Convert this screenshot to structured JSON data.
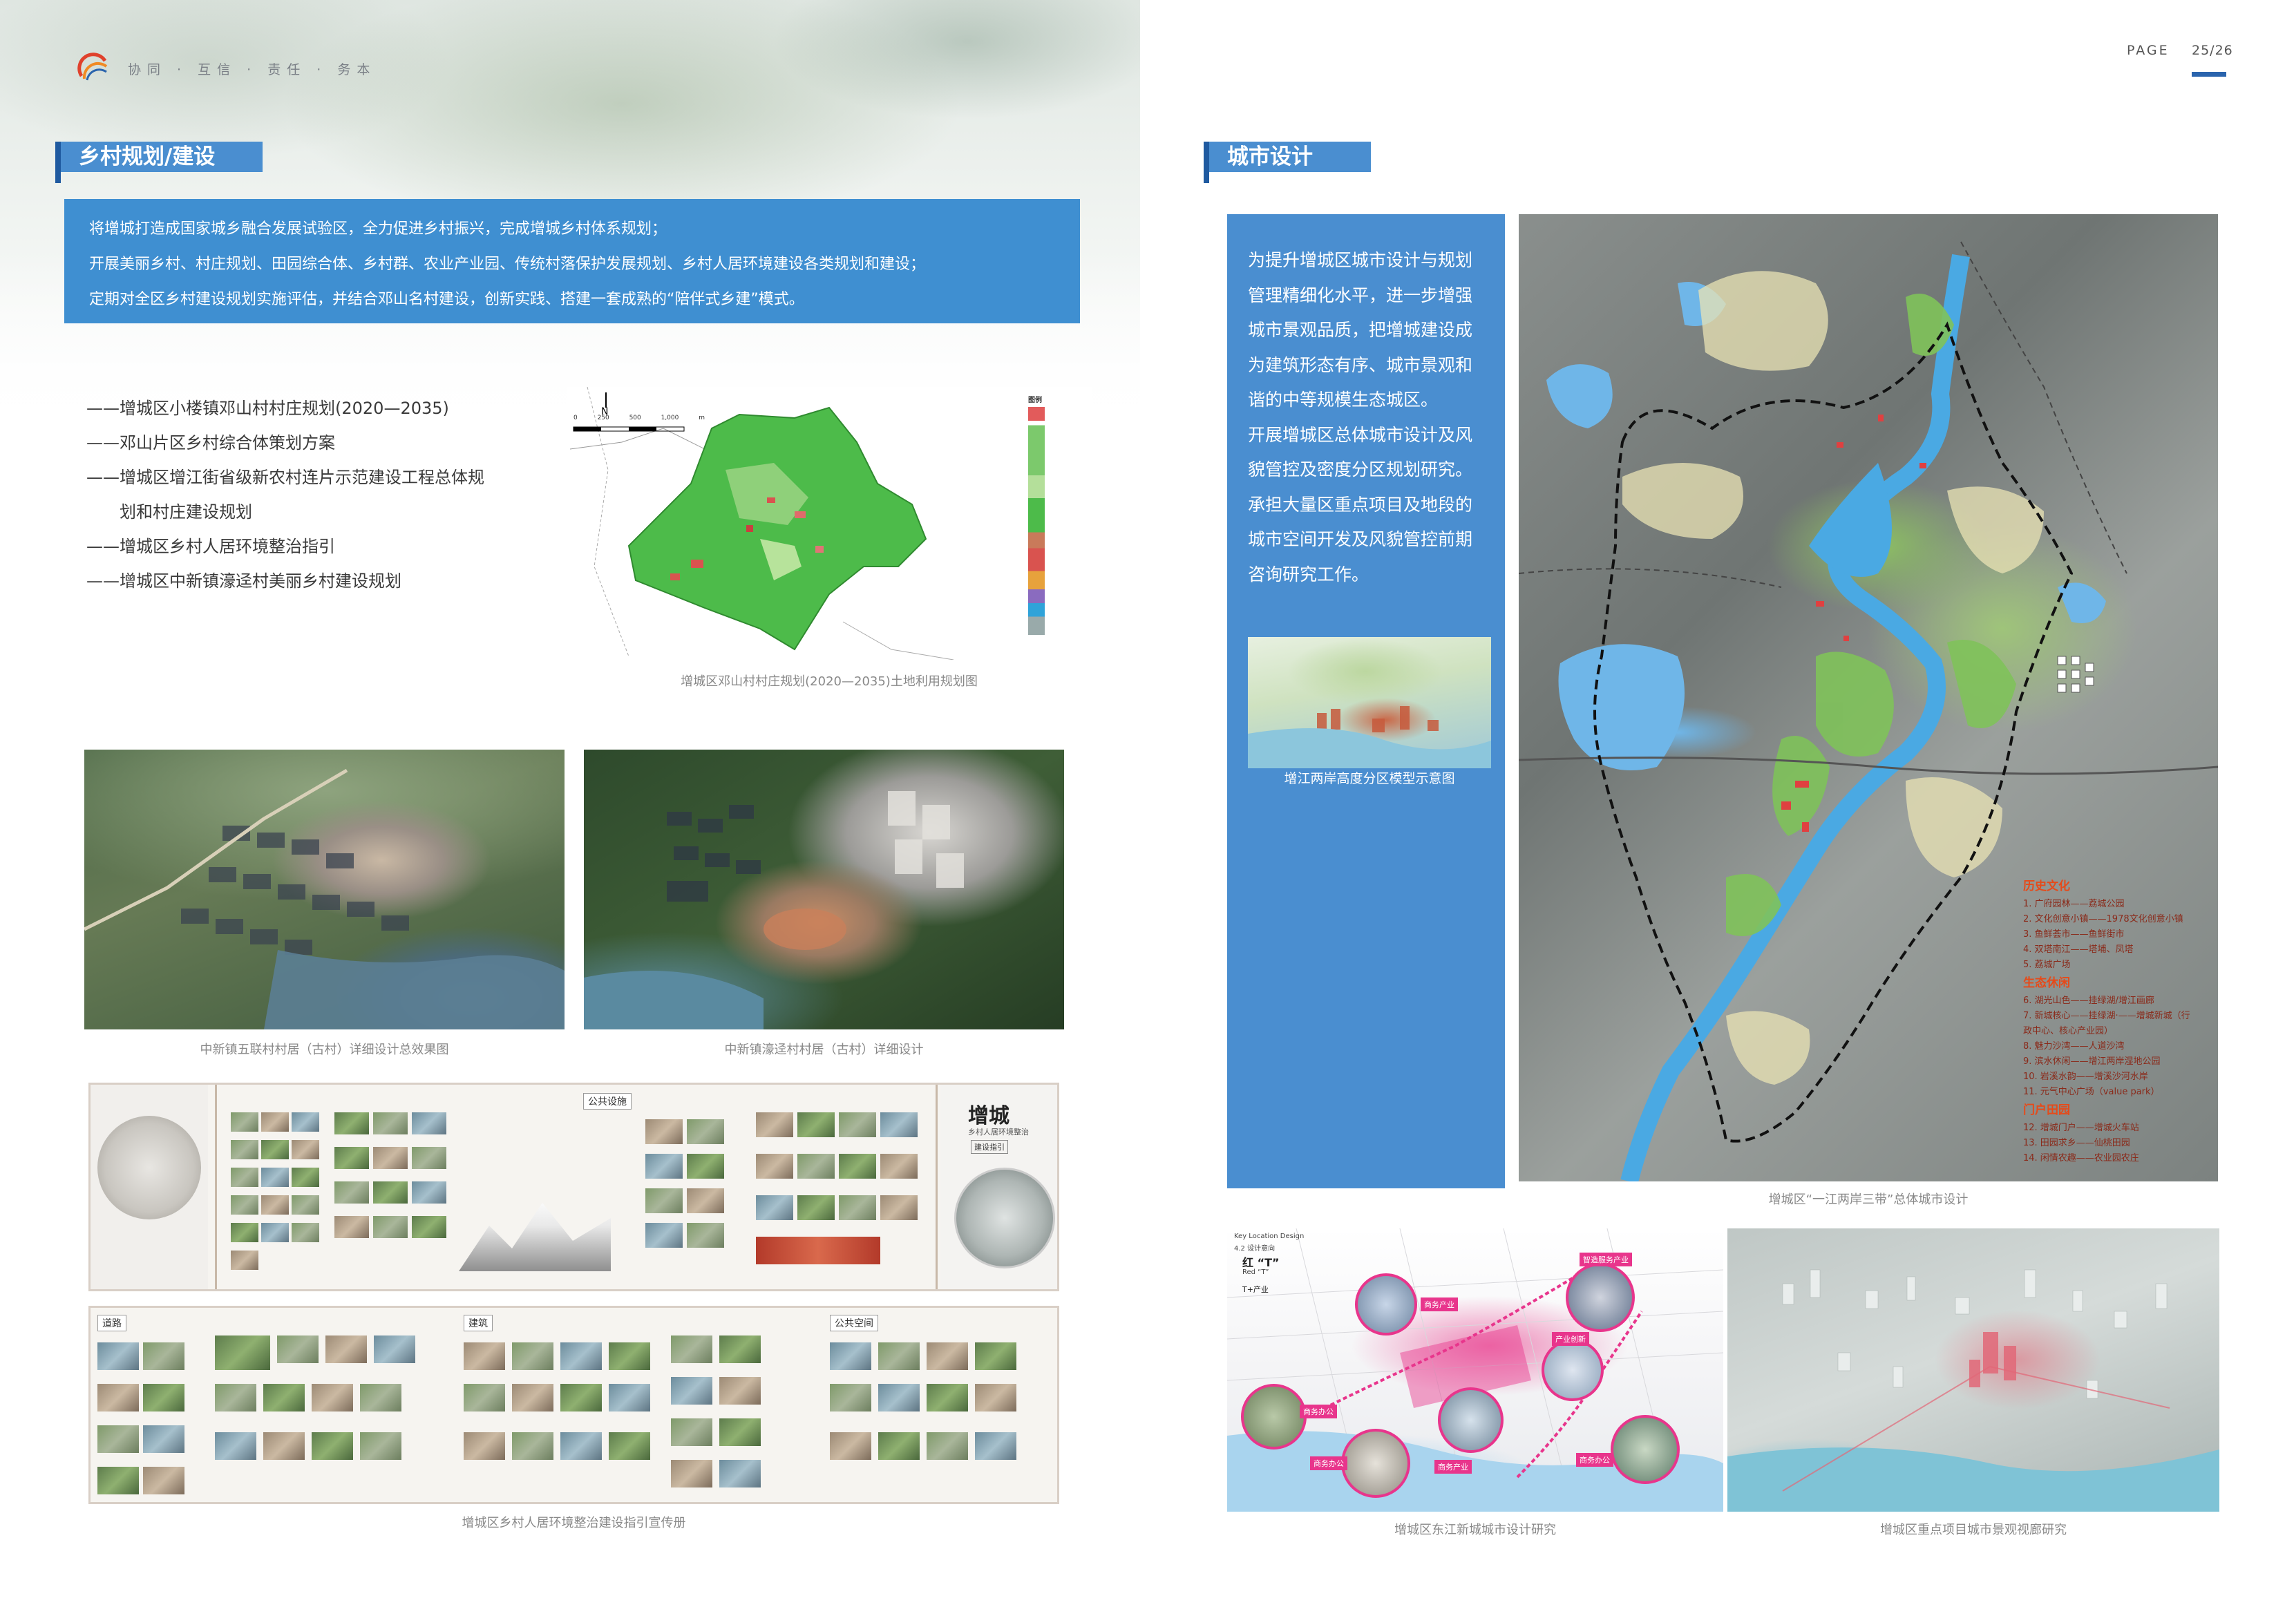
{
  "header": {
    "motto": "协同 · 互信 · 责任 · 务本",
    "page_label": "PAGE",
    "page_number": "25/26",
    "accent_color": "#2a64ad"
  },
  "rural": {
    "title": "乡村规划/建设",
    "intro": [
      "将增城打造成国家城乡融合发展试验区，全力促进乡村振兴，完成增城乡村体系规划；",
      "开展美丽乡村、村庄规划、田园综合体、乡村群、农业产业园、传统村落保护发展规划、乡村人居环境建设各类规划和建设；",
      "定期对全区乡村建设规划实施评估，并结合邓山名村建设，创新实践、搭建一套成熟的“陪伴式乡建”模式。"
    ],
    "projects": [
      "——增城区小楼镇邓山村村庄规划(2020—2035)",
      "——邓山片区乡村综合体策划方案",
      "——增城区增江街省级新农村连片示范建设工程总体规",
      "划和村庄建设规划",
      "——增城区乡村人居环境整治指引",
      "——增城区中新镇濠迳村美丽乡村建设规划"
    ],
    "map_caption": "增城区邓山村村庄规划(2020—2035)土地利用规划图",
    "map_scale": [
      "0",
      "250",
      "500",
      "1,000"
    ],
    "map_scale_unit": "m",
    "map_legend_title": "图例",
    "render1_caption": "中新镇五联村村居（古村）详细设计总效果图",
    "render2_caption": "中新镇濠迳村村居（古村）详细设计",
    "brochure_caption": "增城区乡村人居环境整治建设指引宣传册",
    "brochure": {
      "cover_title": "增城",
      "cover_subtitle": "乡村人居环境整治",
      "cover_tag": "建设指引",
      "section_public": "公共设施",
      "section_road": "道路",
      "section_building": "建筑",
      "section_space": "公共空间"
    }
  },
  "city": {
    "title": "城市设计",
    "text": [
      "为提升增城区城市设计与规划",
      "管理精细化水平，进一步增强",
      "城市景观品质，把增城建设成",
      "为建筑形态有序、城市景观和",
      "谐的中等规模生态城区。",
      "开展增城区总体城市设计及风",
      "貌管控及密度分区规划研究。",
      "承担大量区重点项目及地段的",
      "城市空间开发及风貌管控前期",
      "咨询研究工作。"
    ],
    "thumb_caption": "增江两岸高度分区模型示意图",
    "main_map_caption": "增城区“一江两岸三带”总体城市设计",
    "legend": [
      {
        "heading": "历史文化",
        "items": [
          "1. 广府园林——荔城公园",
          "2. 文化创意小镇——1978文化创意小镇",
          "3. 鱼鲜荟市——鱼鲜街市",
          "4. 双塔南江——塔埔、凤塔",
          "5. 荔城广场"
        ]
      },
      {
        "heading": "生态休闲",
        "items": [
          "6. 湖光山色——挂绿湖/增江画廊",
          "7. 新城核心——挂绿湖·——增城新城（行政中心、核心产业园）",
          "8. 魅力沙湾——人道沙湾",
          "9. 滨水休闲——增江两岸湿地公园",
          "10. 岩溪水韵——增溪沙河水岸",
          "11. 元气中心广场（value park）"
        ]
      },
      {
        "heading": "门户田园",
        "items": [
          "12. 增城门户——增城火车站",
          "13. 田园求乡——仙桃田园",
          "14. 闲情农趣——农业园农庄"
        ]
      }
    ],
    "east_caption": "增城区东江新城城市设计研究",
    "east_diagram": {
      "eyebrow_1": "Key Location Design",
      "eyebrow_2": "4.2 设计意向",
      "title": "红 “T”",
      "title_en": "Red “T”",
      "tag": "T+产业",
      "labels": [
        "商务产业",
        "智造服务产业",
        "产业创新",
        "商务办公",
        "商务办公",
        "商务产业",
        "商务办公"
      ]
    },
    "view_caption": "增城区重点项目城市景观视廊研究"
  }
}
